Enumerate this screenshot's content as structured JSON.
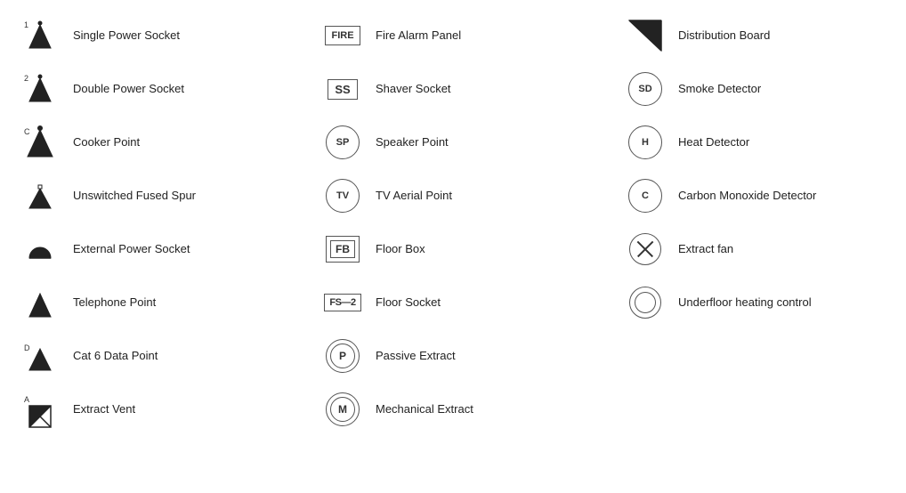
{
  "columns": [
    {
      "id": "col1",
      "items": [
        {
          "id": "single-power-socket",
          "label": "Single Power Socket",
          "symbol_type": "svg_single_socket"
        },
        {
          "id": "double-power-socket",
          "label": "Double Power Socket",
          "symbol_type": "svg_double_socket"
        },
        {
          "id": "cooker-point",
          "label": "Cooker Point",
          "symbol_type": "svg_cooker"
        },
        {
          "id": "unswitched-fused-spur",
          "label": "Unswitched Fused Spur",
          "symbol_type": "svg_fused_spur"
        },
        {
          "id": "external-power-socket",
          "label": "External Power Socket",
          "symbol_type": "svg_external_socket"
        },
        {
          "id": "telephone-point",
          "label": "Telephone Point",
          "symbol_type": "svg_telephone"
        },
        {
          "id": "cat6-data-point",
          "label": "Cat 6 Data Point",
          "symbol_type": "svg_cat6"
        },
        {
          "id": "extract-vent",
          "label": "Extract Vent",
          "symbol_type": "svg_extract_vent"
        }
      ]
    },
    {
      "id": "col2",
      "items": [
        {
          "id": "fire-alarm-panel",
          "label": "Fire Alarm Panel",
          "symbol_type": "box_text",
          "symbol_text": "FIRE"
        },
        {
          "id": "shaver-socket",
          "label": "Shaver Socket",
          "symbol_type": "box_text",
          "symbol_text": "SS"
        },
        {
          "id": "speaker-point",
          "label": "Speaker Point",
          "symbol_type": "circle_text",
          "symbol_text": "SP"
        },
        {
          "id": "tv-aerial-point",
          "label": "TV Aerial Point",
          "symbol_type": "circle_text",
          "symbol_text": "TV"
        },
        {
          "id": "floor-box",
          "label": "Floor Box",
          "symbol_type": "box_double_text",
          "symbol_text": "FB"
        },
        {
          "id": "floor-socket",
          "label": "Floor Socket",
          "symbol_type": "floor_socket_text",
          "symbol_text": "FS—2"
        },
        {
          "id": "passive-extract",
          "label": "Passive Extract",
          "symbol_type": "circle_text_p",
          "symbol_text": "P"
        },
        {
          "id": "mechanical-extract",
          "label": "Mechanical Extract",
          "symbol_type": "circle_double_text",
          "symbol_text": "M"
        }
      ]
    },
    {
      "id": "col3",
      "items": [
        {
          "id": "distribution-board",
          "label": "Distribution Board",
          "symbol_type": "svg_dist_board"
        },
        {
          "id": "smoke-detector",
          "label": "Smoke Detector",
          "symbol_type": "circle_text",
          "symbol_text": "SD"
        },
        {
          "id": "heat-detector",
          "label": "Heat Detector",
          "symbol_type": "circle_text",
          "symbol_text": "H"
        },
        {
          "id": "carbon-monoxide-detector",
          "label": "Carbon Monoxide Detector",
          "symbol_type": "circle_text",
          "symbol_text": "C"
        },
        {
          "id": "extract-fan",
          "label": "Extract fan",
          "symbol_type": "cross_circle"
        },
        {
          "id": "underfloor-heating-control",
          "label": "Underfloor heating control",
          "symbol_type": "concentric_circle"
        }
      ]
    }
  ]
}
